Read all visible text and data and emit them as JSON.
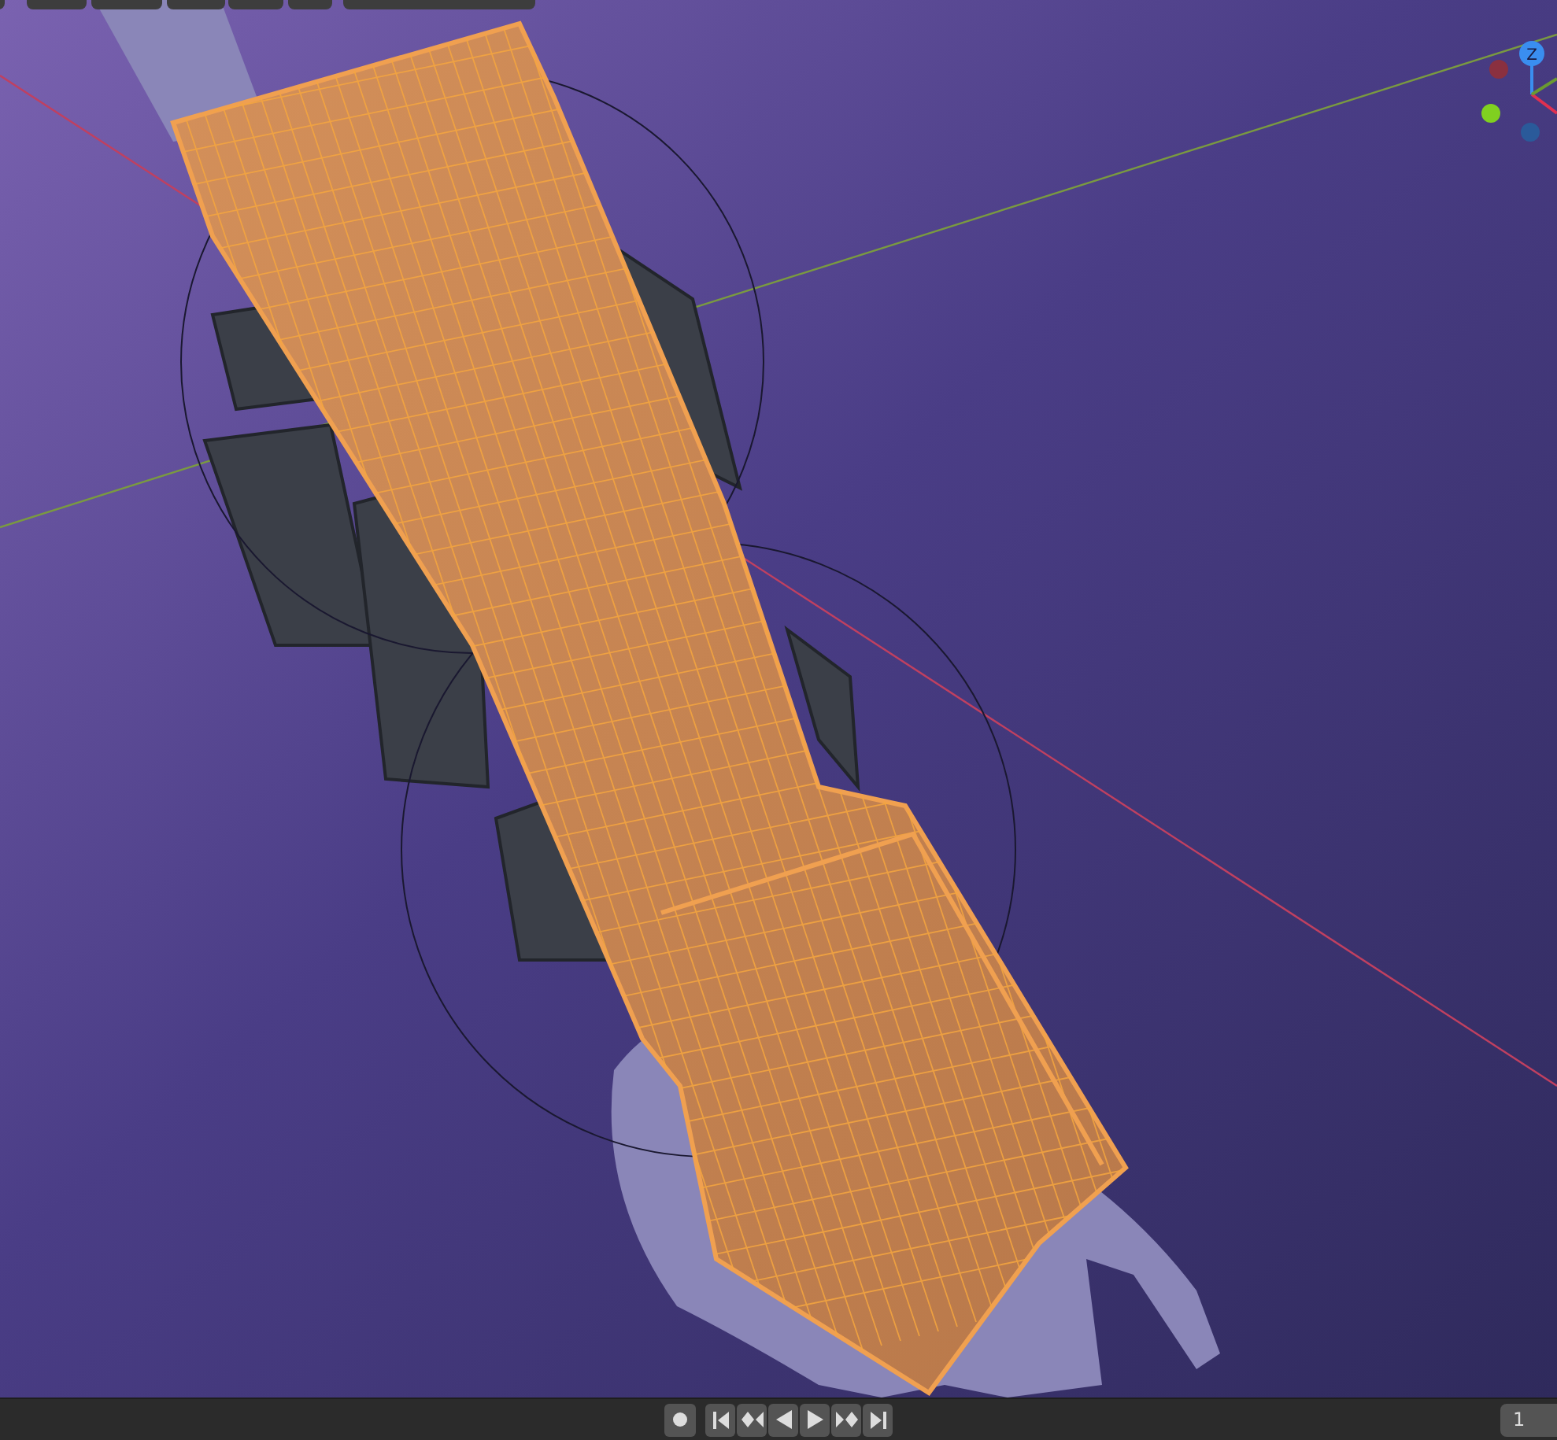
{
  "viewport": {
    "gizmo": {
      "z_label": "Z"
    }
  },
  "timeline": {
    "current_frame": "1"
  }
}
